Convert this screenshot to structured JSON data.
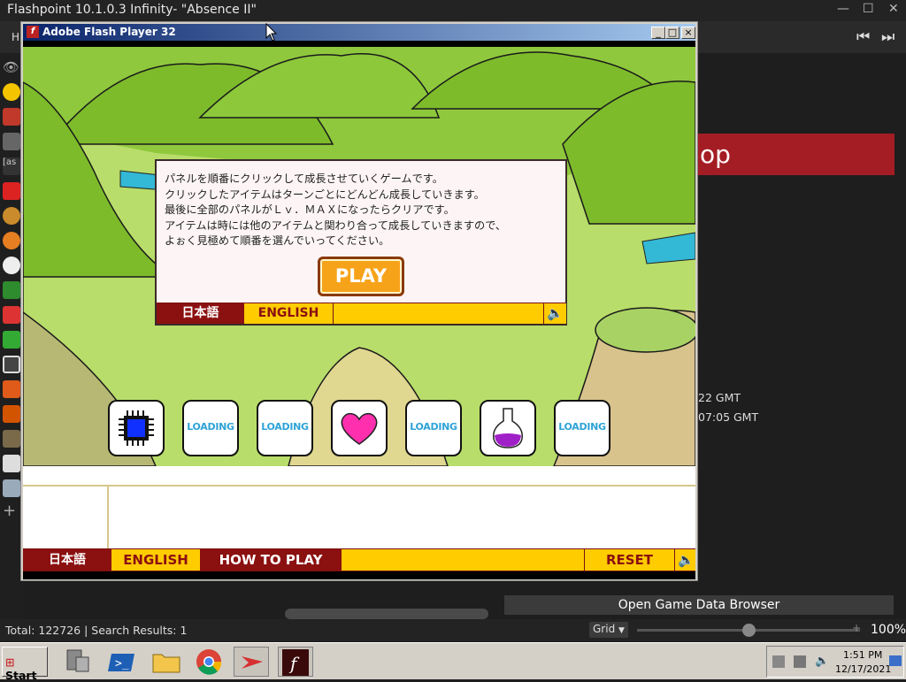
{
  "flashpoint": {
    "title": "Flashpoint 10.1.0.3 Infinity- \"Absence II\"",
    "menu_home": "H",
    "banner_text": "op",
    "gmt_line1": "22 GMT",
    "gmt_line2": "07:05 GMT",
    "open_browser_label": "Open Game Data Browser",
    "status_text": "Total: 122726  |  Search Results: 1",
    "grid_label": "Grid",
    "zoom_percent": "100%",
    "zoom_minus": "-",
    "zoom_plus": "+",
    "zoom_level": 0.5
  },
  "flash_player": {
    "title": "Adobe Flash Player 32",
    "title_icon": "f",
    "min_glyph": "_",
    "max_glyph": "□",
    "close_glyph": "×"
  },
  "dialog": {
    "text": "パネルを順番にクリックして成長させていくゲームです。\nクリックしたアイテムはターンごとにどんどん成長していきます。\n最後に全部のパネルがＬｖ．ＭＡＸになったらクリアです。\nアイテムは時には他のアイテムと関わり合って成長していきますので、\nよぉく見極めて順番を選んでいってください。",
    "play_label": "PLAY",
    "lang_jp": "日本語",
    "lang_en": "ENGLISH",
    "sound_icon": "speaker-icon"
  },
  "tiles": [
    {
      "kind": "chip",
      "label": ""
    },
    {
      "kind": "loading",
      "label": "LOADING"
    },
    {
      "kind": "loading",
      "label": "LOADING"
    },
    {
      "kind": "heart",
      "label": ""
    },
    {
      "kind": "loading",
      "label": "LOADING"
    },
    {
      "kind": "flask",
      "label": ""
    },
    {
      "kind": "loading",
      "label": "LOADING"
    }
  ],
  "bottom_bar": {
    "lang_jp": "日本語",
    "lang_en": "ENGLISH",
    "how_to_play": "HOW TO PLAY",
    "reset": "RESET"
  },
  "taskbar": {
    "start_label": "Start",
    "clock_time": "1:51 PM",
    "clock_date": "12/17/2021",
    "apps": [
      "network-icon",
      "powershell-icon",
      "folder-icon",
      "chrome-icon",
      "flashpoint-icon",
      "flash-player-icon"
    ]
  },
  "colors": {
    "accent_red": "#8b1010",
    "accent_yellow": "#ffcc00",
    "play_orange": "#f7a31a",
    "banner_red": "#a51d24"
  }
}
